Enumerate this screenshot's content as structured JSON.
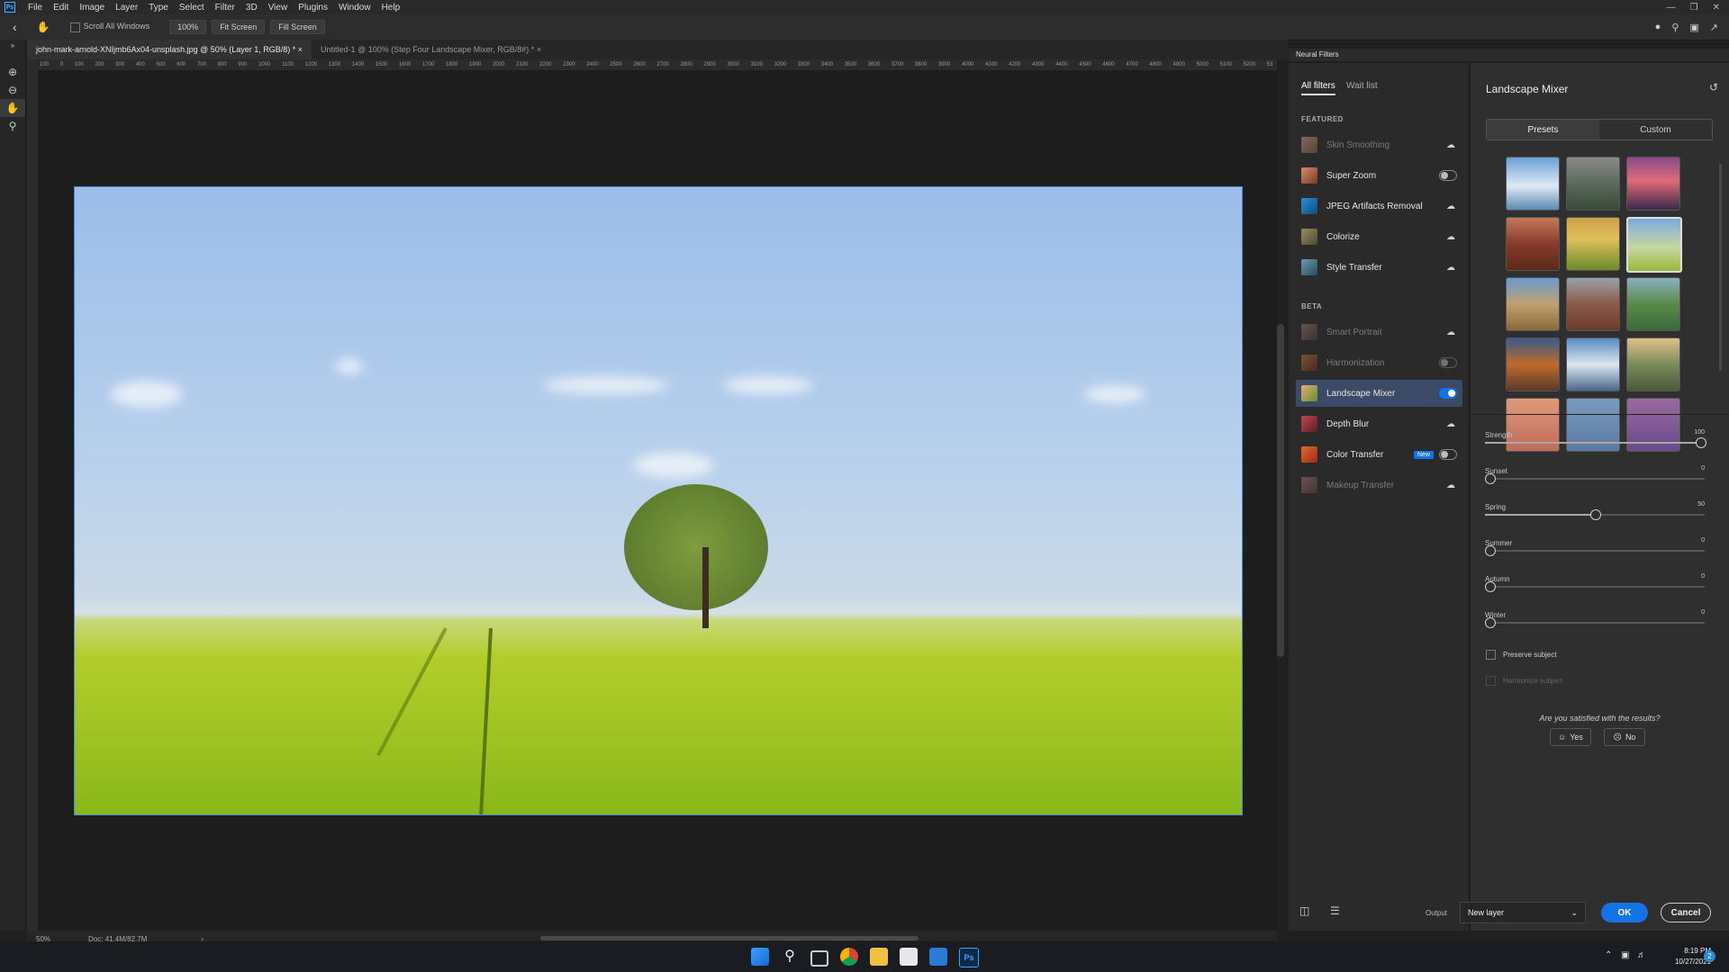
{
  "menu": [
    "File",
    "Edit",
    "Image",
    "Layer",
    "Type",
    "Select",
    "Filter",
    "3D",
    "View",
    "Plugins",
    "Window",
    "Help"
  ],
  "options": {
    "scroll_all": "Scroll All Windows",
    "zoom": "100%",
    "fit": "Fit Screen",
    "fill": "Fill Screen"
  },
  "tabs": [
    {
      "label": "john-mark-arnold-XNIjmb6Ax04-unsplash.jpg @ 50% (Layer 1, RGB/8) *"
    },
    {
      "label": "Untitled-1 @ 100% (Step Four Landscape Mixer, RGB/8#) *"
    }
  ],
  "ruler_ticks": [
    "100",
    "0",
    "100",
    "200",
    "300",
    "400",
    "500",
    "600",
    "700",
    "800",
    "900",
    "1000",
    "1100",
    "1200",
    "1300",
    "1400",
    "1500",
    "1600",
    "1700",
    "1800",
    "1900",
    "2000",
    "2100",
    "2200",
    "2300",
    "2400",
    "2500",
    "2600",
    "2700",
    "2800",
    "2900",
    "3000",
    "3100",
    "3200",
    "3300",
    "3400",
    "3500",
    "3600",
    "3700",
    "3800",
    "3900",
    "4000",
    "4100",
    "4200",
    "4300",
    "4400",
    "4500",
    "4600",
    "4700",
    "4800",
    "4900",
    "5000",
    "5100",
    "5200",
    "53"
  ],
  "status": {
    "zoom": "50%",
    "doc": "Doc: 41.4M/82.7M"
  },
  "neural": {
    "panel_title": "Neural Filters",
    "tab_all": "All filters",
    "tab_wait": "Wait list",
    "featured_heading": "FEATURED",
    "beta_heading": "BETA",
    "featured": [
      {
        "label": "Skin Smoothing",
        "state": "download",
        "dim": true
      },
      {
        "label": "Super Zoom",
        "state": "toggle-off",
        "dim": false
      },
      {
        "label": "JPEG Artifacts Removal",
        "state": "download",
        "dim": false
      },
      {
        "label": "Colorize",
        "state": "download",
        "dim": false
      },
      {
        "label": "Style Transfer",
        "state": "download",
        "dim": false
      }
    ],
    "beta": [
      {
        "label": "Smart Portrait",
        "state": "download",
        "dim": true
      },
      {
        "label": "Harmonization",
        "state": "toggle-off",
        "dim": true
      },
      {
        "label": "Landscape Mixer",
        "state": "toggle-on",
        "dim": false
      },
      {
        "label": "Depth Blur",
        "state": "download",
        "dim": false
      },
      {
        "label": "Color Transfer",
        "state": "toggle-off",
        "dim": false,
        "badge": "New"
      },
      {
        "label": "Makeup Transfer",
        "state": "download",
        "dim": true
      }
    ],
    "mixer_title": "Landscape Mixer",
    "presets_tab": "Presets",
    "custom_tab": "Custom",
    "sliders": [
      {
        "label": "Strength",
        "value": 100
      },
      {
        "label": "Sunset",
        "value": 0
      },
      {
        "label": "Spring",
        "value": 50
      },
      {
        "label": "Summer",
        "value": 0
      },
      {
        "label": "Autumn",
        "value": 0
      },
      {
        "label": "Winter",
        "value": 0
      }
    ],
    "preserve": "Preserve subject",
    "harmonize": "Harmonize subject",
    "question": "Are you satisfied with the results?",
    "yes": "Yes",
    "no": "No",
    "output_label": "Output",
    "output_value": "New layer",
    "ok": "OK",
    "cancel": "Cancel"
  },
  "clock": {
    "time": "8:19 PM",
    "date": "10/27/2021"
  },
  "notif_count": "2",
  "colors": {
    "accent": "#1473e6",
    "selected_row": "#3b4a66"
  }
}
